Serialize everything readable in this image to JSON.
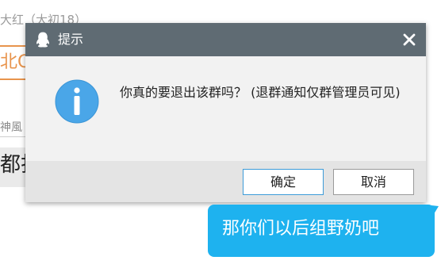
{
  "background": {
    "sender_name": "大红（大初18）",
    "title_fragment": "北CF",
    "sub_fragment": "神風",
    "big_fragment": "都打"
  },
  "dialog": {
    "title": "提示",
    "message": "你真的要退出该群吗？ (退群通知仅群管理员可见)",
    "ok_label": "确定",
    "cancel_label": "取消",
    "titlebar_color": "#5f6b73",
    "info_icon_color": "#4aa6e8"
  },
  "bubble": {
    "text": "那你们以后组野奶吧",
    "color": "#1eb2ef"
  },
  "icons": {
    "title": "qq-penguin-icon",
    "close": "close-icon",
    "info": "info-icon"
  }
}
